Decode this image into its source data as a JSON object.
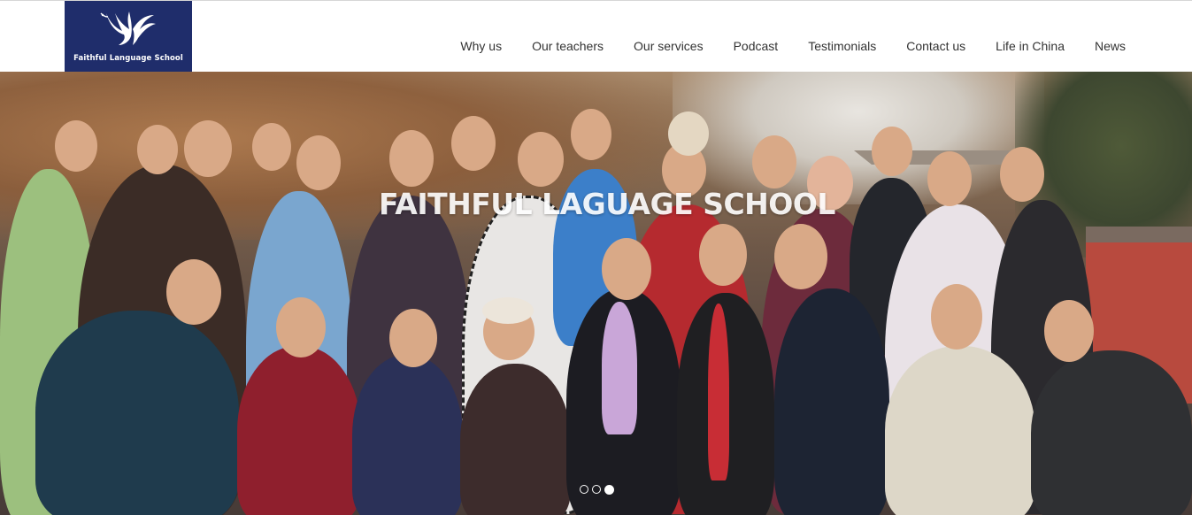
{
  "header": {
    "logo": {
      "icon": "bird-wings-logo-icon",
      "text": "Faithful Language School"
    },
    "nav": [
      {
        "label": "Why us"
      },
      {
        "label": "Our teachers"
      },
      {
        "label": "Our services"
      },
      {
        "label": "Podcast"
      },
      {
        "label": "Testimonials"
      },
      {
        "label": "Contact us"
      },
      {
        "label": "Life in China"
      },
      {
        "label": "News"
      }
    ]
  },
  "hero": {
    "title": "FAITHFUL LAGUAGE SCHOOL",
    "slides": 3,
    "active_slide": 3
  },
  "colors": {
    "brand": "#1f2d6b",
    "nav_text": "#333333",
    "hero_text": "#ffffff"
  }
}
